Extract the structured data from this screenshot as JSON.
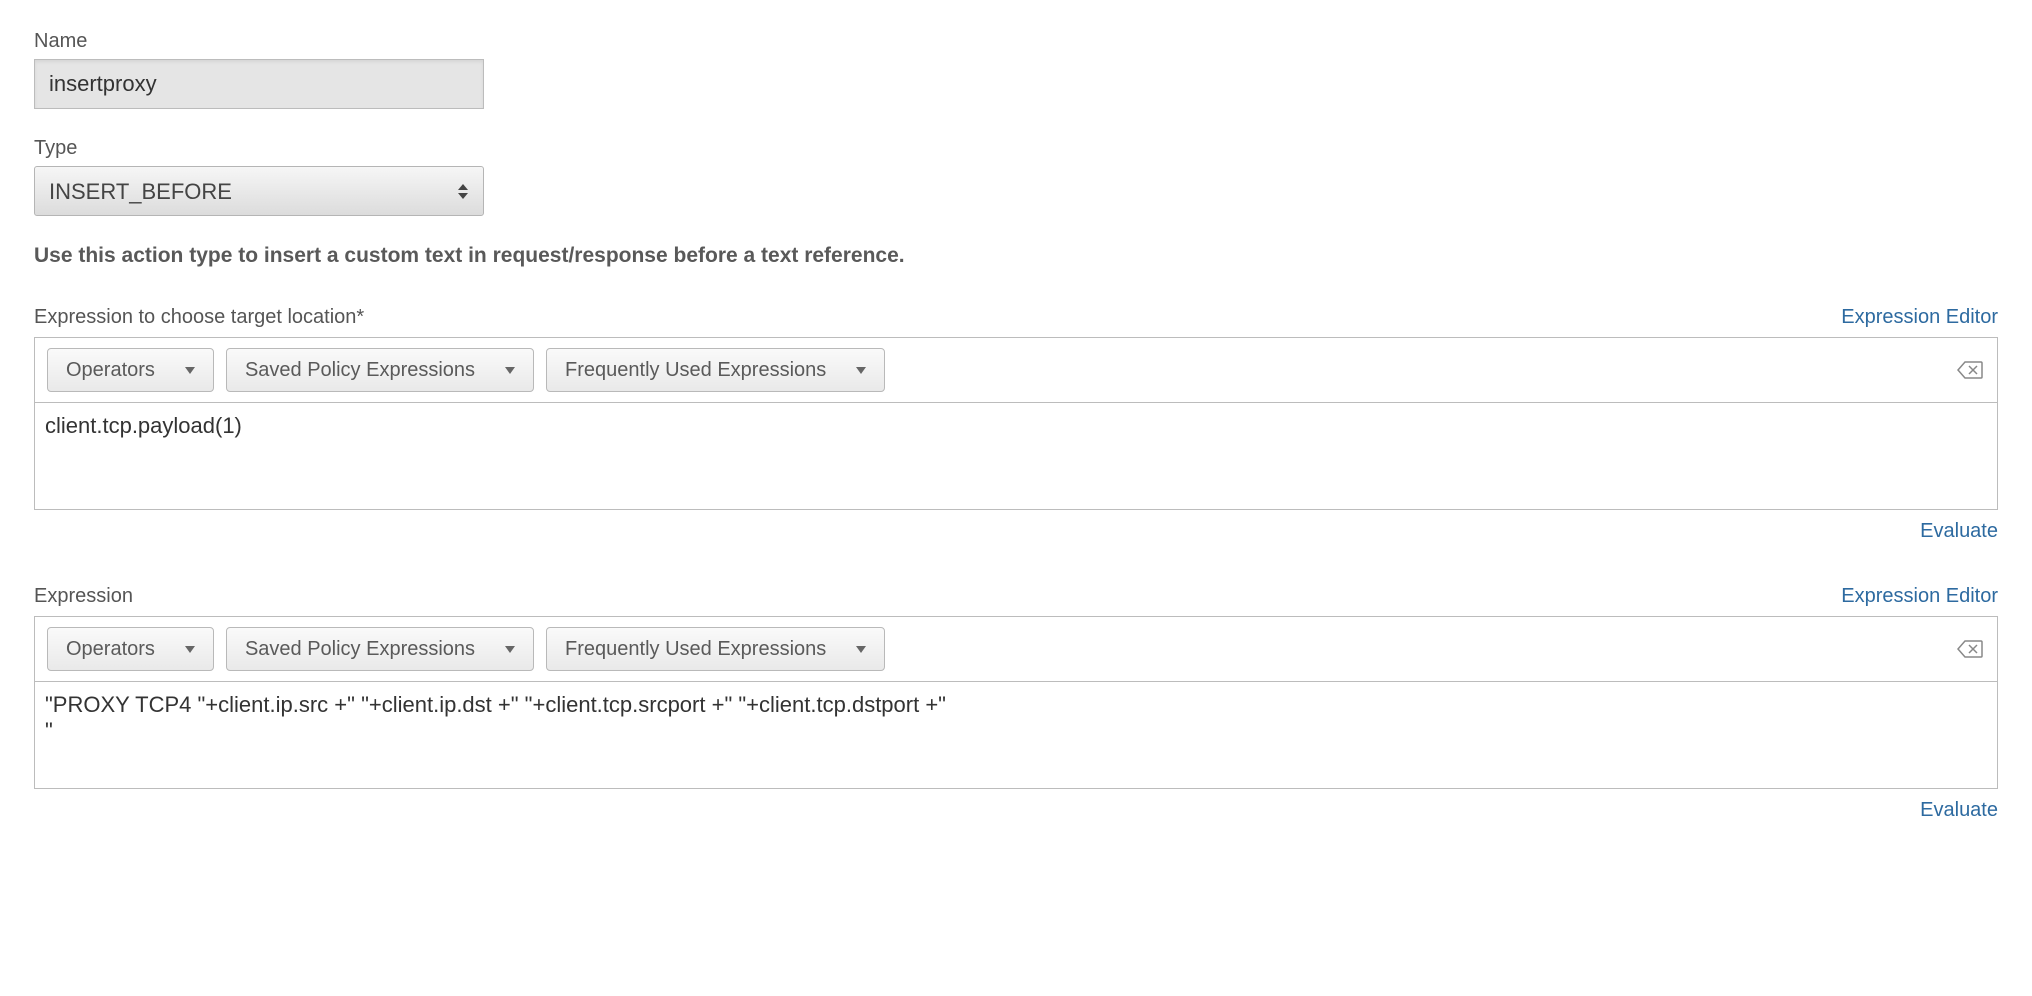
{
  "labels": {
    "name": "Name",
    "type": "Type",
    "help": "Use this action type to insert a custom text in request/response before a text reference."
  },
  "values": {
    "name": "insertproxy",
    "type": "INSERT_BEFORE"
  },
  "toolbar": {
    "operators": "Operators",
    "saved": "Saved Policy Expressions",
    "freq": "Frequently Used Expressions"
  },
  "links": {
    "editor": "Expression Editor",
    "evaluate": "Evaluate"
  },
  "section1": {
    "label": "Expression to choose target location*",
    "value": "client.tcp.payload(1)"
  },
  "section2": {
    "label": "Expression",
    "value": "\"PROXY TCP4 \"+client.ip.src +\" \"+client.ip.dst +\" \"+client.tcp.srcport +\" \"+client.tcp.dstport +\"\n\""
  }
}
